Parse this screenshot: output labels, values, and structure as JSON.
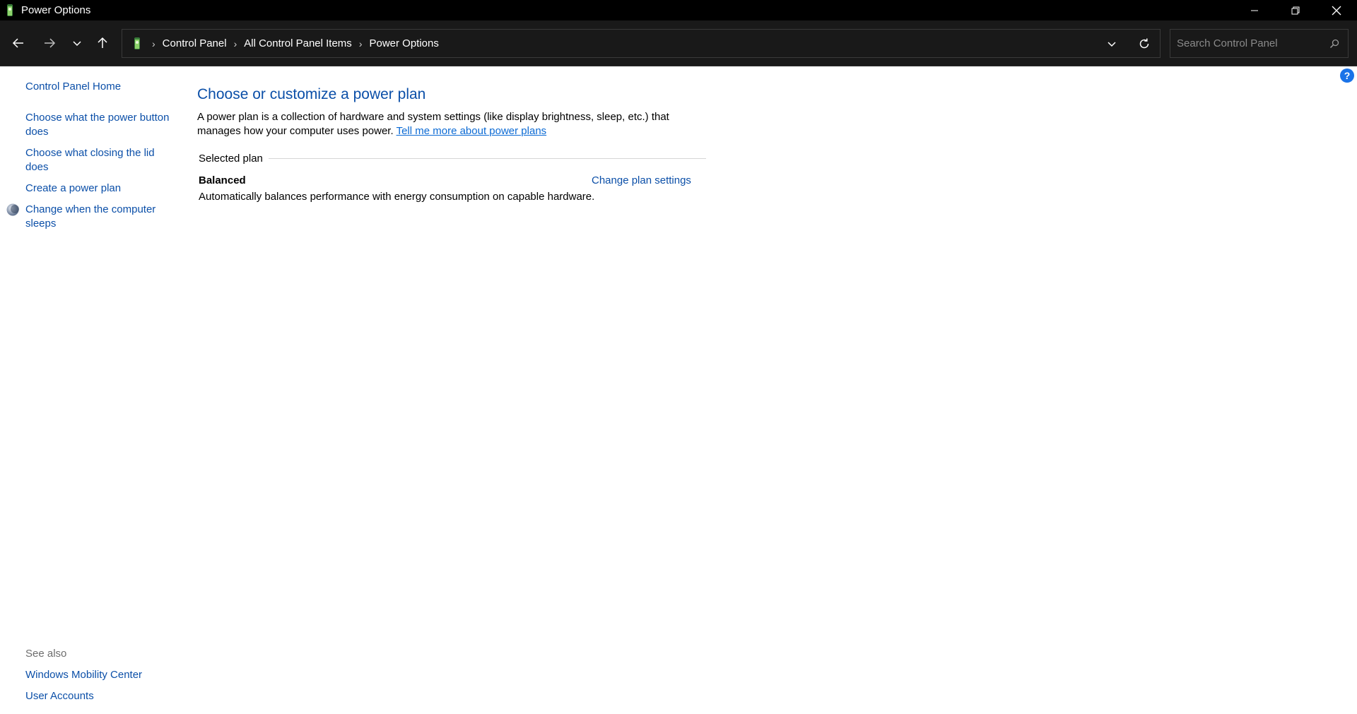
{
  "window": {
    "title": "Power Options"
  },
  "navigation": {
    "breadcrumbs": [
      "Control Panel",
      "All Control Panel Items",
      "Power Options"
    ],
    "search": {
      "placeholder": "Search Control Panel"
    }
  },
  "sidebar": {
    "home_link": "Control Panel Home",
    "tasks": [
      "Choose what the power button does",
      "Choose what closing the lid does",
      "Create a power plan",
      "Change when the computer sleeps"
    ],
    "see_also": {
      "heading": "See also",
      "links": [
        "Windows Mobility Center",
        "User Accounts"
      ]
    }
  },
  "main": {
    "title": "Choose or customize a power plan",
    "intro_text": "A power plan is a collection of hardware and system settings (like display brightness, sleep, etc.) that manages how your computer uses power.",
    "intro_link": "Tell me more about power plans",
    "section_label": "Selected plan",
    "plan": {
      "name": "Balanced",
      "settings_link": "Change plan settings",
      "description": "Automatically balances performance with energy consumption on capable hardware."
    }
  },
  "help": {
    "label": "?"
  },
  "colors": {
    "link": "#0b4fa8",
    "titlebar": "#000000",
    "navbar": "#191919",
    "help": "#1a73e8"
  }
}
